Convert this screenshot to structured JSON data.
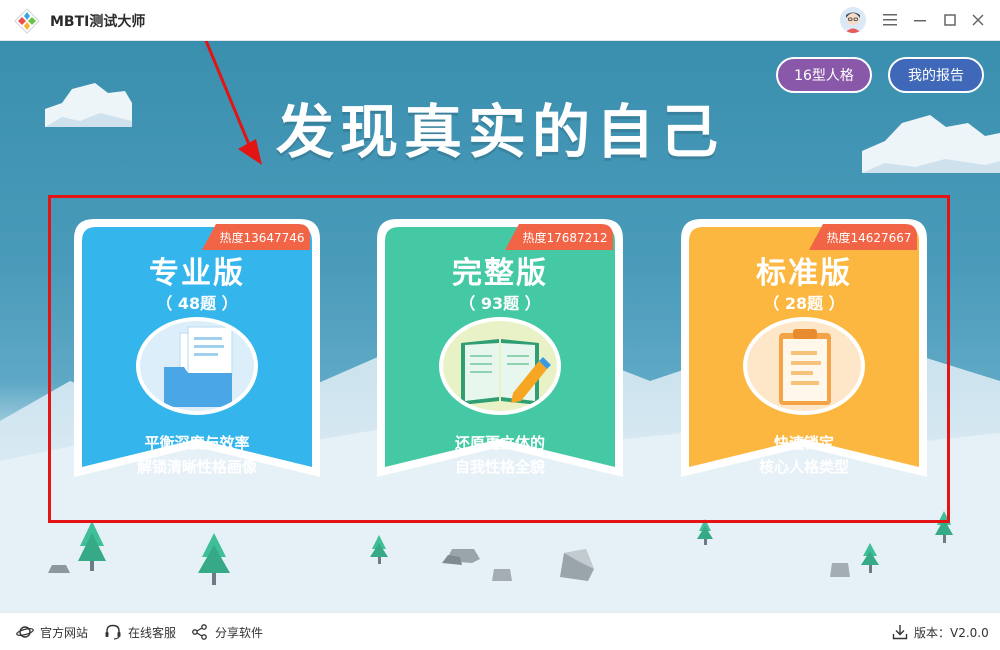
{
  "app": {
    "title": "MBTI测试大师"
  },
  "header": {
    "headline": "发现真实的自己",
    "btn_16": "16型人格",
    "btn_report": "我的报告"
  },
  "cards": [
    {
      "heat": "热度13647746",
      "title": "专业版",
      "count": "（ 48题 ）",
      "desc1": "平衡深度与效率",
      "desc2": "解锁清晰性格画像",
      "color": "#34b6ec",
      "icon": "folder-documents-icon"
    },
    {
      "heat": "热度17687212",
      "title": "完整版",
      "count": "（ 93题 ）",
      "desc1": "还原更立体的",
      "desc2": "自我性格全貌",
      "color": "#45c9a4",
      "icon": "open-book-pen-icon"
    },
    {
      "heat": "热度14627667",
      "title": "标准版",
      "count": "（ 28题 ）",
      "desc1": "快速锁定",
      "desc2": "核心人格类型",
      "color": "#fcb740",
      "icon": "clipboard-icon"
    }
  ],
  "footer": {
    "website": "官方网站",
    "service": "在线客服",
    "share": "分享软件",
    "version": "版本：V2.0.0"
  },
  "colors": {
    "sky": "#3a8fae",
    "badge": "#f26446",
    "highlight": "#e21414",
    "btn_16": "#8a58a8",
    "btn_report": "#3f69b8"
  }
}
